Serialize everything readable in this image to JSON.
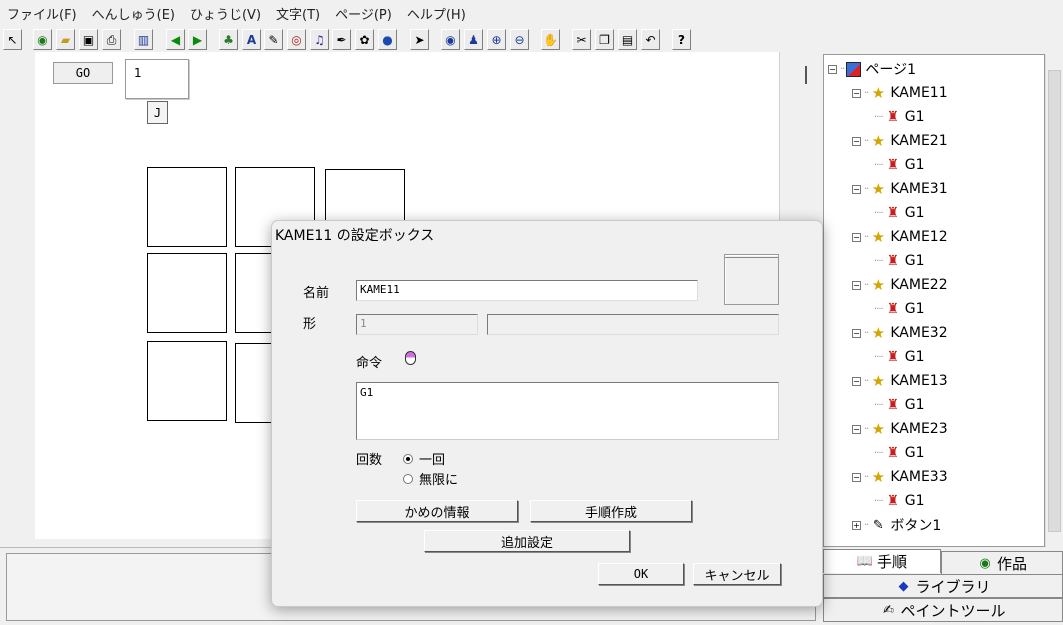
{
  "menu": [
    "ファイル(F)",
    "へんしゅう(E)",
    "ひょうじ(V)",
    "文字(T)",
    "ページ(P)",
    "ヘルプ(H)"
  ],
  "toolbar": {
    "icons": [
      "select-arrow-icon",
      "globe-icon",
      "open-folder-icon",
      "save-disk-icon",
      "print-icon",
      "layout-icon",
      "back-arrow-icon",
      "forward-arrow-icon",
      "turtle-icon",
      "text-a-icon",
      "stamp-icon",
      "eye-icon",
      "music-note-icon",
      "paint-icon",
      "camera-icon",
      "robot-icon",
      "cursor-icon",
      "view-icon",
      "person-icon",
      "zoom-in-icon",
      "zoom-out-icon",
      "stop-icon",
      "cut-icon",
      "copy-icon",
      "paste-icon",
      "undo-icon",
      "help-icon"
    ],
    "help_label": "?"
  },
  "canvas": {
    "go_label": "GO",
    "number_value": "1",
    "j_label": "J"
  },
  "tree": {
    "root": "ページ1",
    "turtles": [
      "KAME11",
      "KAME21",
      "KAME31",
      "KAME12",
      "KAME22",
      "KAME32",
      "KAME13",
      "KAME23",
      "KAME33"
    ],
    "command": "G1",
    "button_node": "ボタン1"
  },
  "tabs": {
    "procedure": "手順",
    "work": "作品",
    "library": "ライブラリ",
    "paint_tool": "ペイントツール"
  },
  "dialog": {
    "title": "KAME11 の設定ボックス",
    "name_label": "名前",
    "name_value": "KAME11",
    "shape_label": "形",
    "shape_value": "1",
    "command_label": "命令",
    "command_value": "G1",
    "count_label": "回数",
    "count_options": [
      "一回",
      "無限に"
    ],
    "count_selected": "一回",
    "turtle_info_button": "かめの情報",
    "procedure_button": "手順作成",
    "additional_button": "追加設定",
    "ok_button": "OK",
    "cancel_button": "キャンセル"
  }
}
